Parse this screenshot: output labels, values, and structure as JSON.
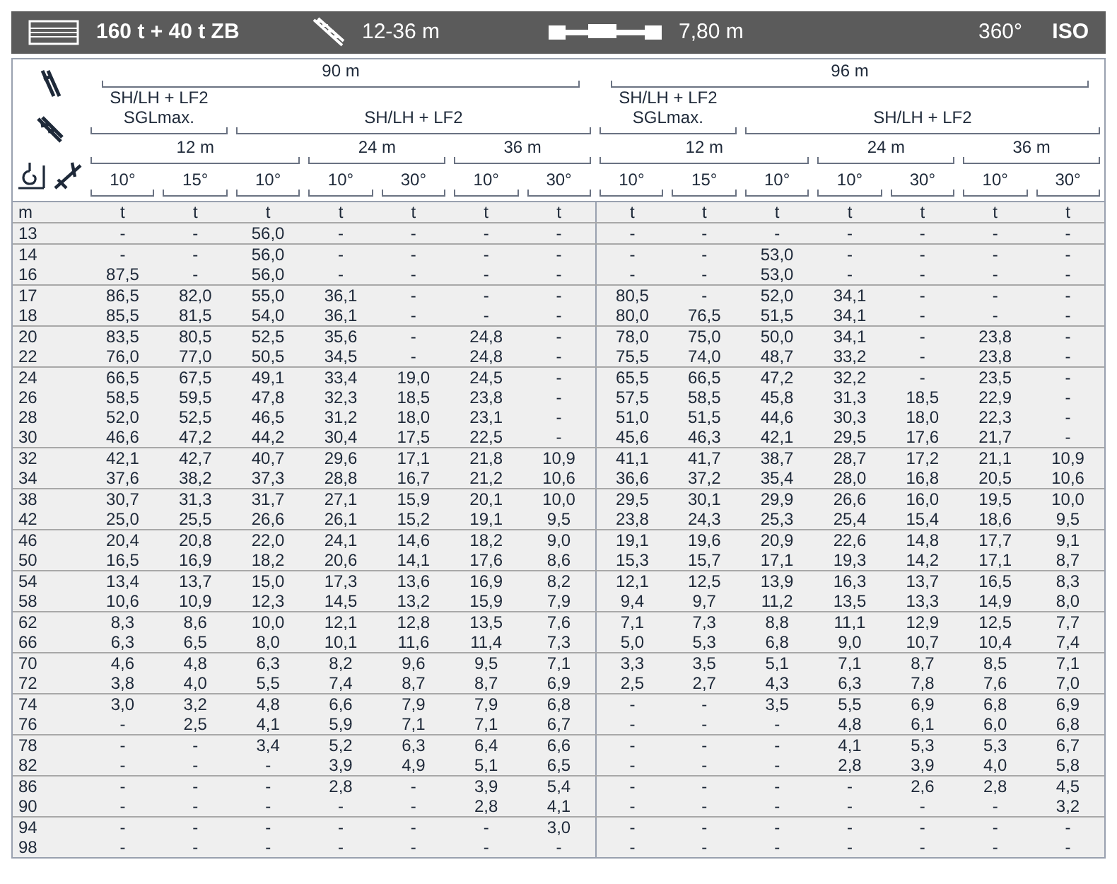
{
  "title_bar": {
    "counterweight": "160 t + 40 t ZB",
    "jib_range": "12-36 m",
    "outrigger_base": "7,80 m",
    "slewing": "360°",
    "standard": "ISO"
  },
  "halves": [
    {
      "main_boom": "90 m",
      "configs": [
        {
          "lines": [
            "SH/LH + LF2",
            "SGLmax."
          ]
        },
        {
          "lines": [
            "SH/LH + LF2"
          ]
        }
      ],
      "jibs": [
        {
          "length": "12 m"
        },
        {
          "length": "24 m"
        },
        {
          "length": "36 m"
        }
      ],
      "angles": [
        "10°",
        "15°",
        "10°",
        "10°",
        "30°",
        "10°",
        "30°"
      ]
    },
    {
      "main_boom": "96 m",
      "configs": [
        {
          "lines": [
            "SH/LH + LF2",
            "SGLmax."
          ]
        },
        {
          "lines": [
            "SH/LH + LF2"
          ]
        }
      ],
      "jibs": [
        {
          "length": "12 m"
        },
        {
          "length": "24 m"
        },
        {
          "length": "36 m"
        }
      ],
      "angles": [
        "10°",
        "15°",
        "10°",
        "10°",
        "30°",
        "10°",
        "30°"
      ]
    }
  ],
  "units": [
    "m",
    "t",
    "t",
    "t",
    "t",
    "t",
    "t",
    "t",
    "t",
    "t",
    "t",
    "t",
    "t",
    "t",
    "t"
  ],
  "row_groups": [
    [
      {
        "m": "13",
        "cells": [
          "-",
          "-",
          "56,0",
          "-",
          "-",
          "-",
          "-",
          "-",
          "-",
          "-",
          "-",
          "-",
          "-",
          "-"
        ]
      }
    ],
    [
      {
        "m": "14",
        "cells": [
          "-",
          "-",
          "56,0",
          "-",
          "-",
          "-",
          "-",
          "-",
          "-",
          "53,0",
          "-",
          "-",
          "-",
          "-"
        ]
      },
      {
        "m": "16",
        "cells": [
          "87,5",
          "-",
          "56,0",
          "-",
          "-",
          "-",
          "-",
          "-",
          "-",
          "53,0",
          "-",
          "-",
          "-",
          "-"
        ]
      }
    ],
    [
      {
        "m": "17",
        "cells": [
          "86,5",
          "82,0",
          "55,0",
          "36,1",
          "-",
          "-",
          "-",
          "80,5",
          "-",
          "52,0",
          "34,1",
          "-",
          "-",
          "-"
        ]
      },
      {
        "m": "18",
        "cells": [
          "85,5",
          "81,5",
          "54,0",
          "36,1",
          "-",
          "-",
          "-",
          "80,0",
          "76,5",
          "51,5",
          "34,1",
          "-",
          "-",
          "-"
        ]
      }
    ],
    [
      {
        "m": "20",
        "cells": [
          "83,5",
          "80,5",
          "52,5",
          "35,6",
          "-",
          "24,8",
          "-",
          "78,0",
          "75,0",
          "50,0",
          "34,1",
          "-",
          "23,8",
          "-"
        ]
      },
      {
        "m": "22",
        "cells": [
          "76,0",
          "77,0",
          "50,5",
          "34,5",
          "-",
          "24,8",
          "-",
          "75,5",
          "74,0",
          "48,7",
          "33,2",
          "-",
          "23,8",
          "-"
        ]
      }
    ],
    [
      {
        "m": "24",
        "cells": [
          "66,5",
          "67,5",
          "49,1",
          "33,4",
          "19,0",
          "24,5",
          "-",
          "65,5",
          "66,5",
          "47,2",
          "32,2",
          "-",
          "23,5",
          "-"
        ]
      },
      {
        "m": "26",
        "cells": [
          "58,5",
          "59,5",
          "47,8",
          "32,3",
          "18,5",
          "23,8",
          "-",
          "57,5",
          "58,5",
          "45,8",
          "31,3",
          "18,5",
          "22,9",
          "-"
        ]
      },
      {
        "m": "28",
        "cells": [
          "52,0",
          "52,5",
          "46,5",
          "31,2",
          "18,0",
          "23,1",
          "-",
          "51,0",
          "51,5",
          "44,6",
          "30,3",
          "18,0",
          "22,3",
          "-"
        ]
      },
      {
        "m": "30",
        "cells": [
          "46,6",
          "47,2",
          "44,2",
          "30,4",
          "17,5",
          "22,5",
          "-",
          "45,6",
          "46,3",
          "42,1",
          "29,5",
          "17,6",
          "21,7",
          "-"
        ]
      }
    ],
    [
      {
        "m": "32",
        "cells": [
          "42,1",
          "42,7",
          "40,7",
          "29,6",
          "17,1",
          "21,8",
          "10,9",
          "41,1",
          "41,7",
          "38,7",
          "28,7",
          "17,2",
          "21,1",
          "10,9"
        ]
      },
      {
        "m": "34",
        "cells": [
          "37,6",
          "38,2",
          "37,3",
          "28,8",
          "16,7",
          "21,2",
          "10,6",
          "36,6",
          "37,2",
          "35,4",
          "28,0",
          "16,8",
          "20,5",
          "10,6"
        ]
      }
    ],
    [
      {
        "m": "38",
        "cells": [
          "30,7",
          "31,3",
          "31,7",
          "27,1",
          "15,9",
          "20,1",
          "10,0",
          "29,5",
          "30,1",
          "29,9",
          "26,6",
          "16,0",
          "19,5",
          "10,0"
        ]
      },
      {
        "m": "42",
        "cells": [
          "25,0",
          "25,5",
          "26,6",
          "26,1",
          "15,2",
          "19,1",
          "9,5",
          "23,8",
          "24,3",
          "25,3",
          "25,4",
          "15,4",
          "18,6",
          "9,5"
        ]
      }
    ],
    [
      {
        "m": "46",
        "cells": [
          "20,4",
          "20,8",
          "22,0",
          "24,1",
          "14,6",
          "18,2",
          "9,0",
          "19,1",
          "19,6",
          "20,9",
          "22,6",
          "14,8",
          "17,7",
          "9,1"
        ]
      },
      {
        "m": "50",
        "cells": [
          "16,5",
          "16,9",
          "18,2",
          "20,6",
          "14,1",
          "17,6",
          "8,6",
          "15,3",
          "15,7",
          "17,1",
          "19,3",
          "14,2",
          "17,1",
          "8,7"
        ]
      }
    ],
    [
      {
        "m": "54",
        "cells": [
          "13,4",
          "13,7",
          "15,0",
          "17,3",
          "13,6",
          "16,9",
          "8,2",
          "12,1",
          "12,5",
          "13,9",
          "16,3",
          "13,7",
          "16,5",
          "8,3"
        ]
      },
      {
        "m": "58",
        "cells": [
          "10,6",
          "10,9",
          "12,3",
          "14,5",
          "13,2",
          "15,9",
          "7,9",
          "9,4",
          "9,7",
          "11,2",
          "13,5",
          "13,3",
          "14,9",
          "8,0"
        ]
      }
    ],
    [
      {
        "m": "62",
        "cells": [
          "8,3",
          "8,6",
          "10,0",
          "12,1",
          "12,8",
          "13,5",
          "7,6",
          "7,1",
          "7,3",
          "8,8",
          "11,1",
          "12,9",
          "12,5",
          "7,7"
        ]
      },
      {
        "m": "66",
        "cells": [
          "6,3",
          "6,5",
          "8,0",
          "10,1",
          "11,6",
          "11,4",
          "7,3",
          "5,0",
          "5,3",
          "6,8",
          "9,0",
          "10,7",
          "10,4",
          "7,4"
        ]
      }
    ],
    [
      {
        "m": "70",
        "cells": [
          "4,6",
          "4,8",
          "6,3",
          "8,2",
          "9,6",
          "9,5",
          "7,1",
          "3,3",
          "3,5",
          "5,1",
          "7,1",
          "8,7",
          "8,5",
          "7,1"
        ]
      },
      {
        "m": "72",
        "cells": [
          "3,8",
          "4,0",
          "5,5",
          "7,4",
          "8,7",
          "8,7",
          "6,9",
          "2,5",
          "2,7",
          "4,3",
          "6,3",
          "7,8",
          "7,6",
          "7,0"
        ]
      }
    ],
    [
      {
        "m": "74",
        "cells": [
          "3,0",
          "3,2",
          "4,8",
          "6,6",
          "7,9",
          "7,9",
          "6,8",
          "-",
          "-",
          "3,5",
          "5,5",
          "6,9",
          "6,8",
          "6,9"
        ]
      },
      {
        "m": "76",
        "cells": [
          "-",
          "2,5",
          "4,1",
          "5,9",
          "7,1",
          "7,1",
          "6,7",
          "-",
          "-",
          "-",
          "4,8",
          "6,1",
          "6,0",
          "6,8"
        ]
      }
    ],
    [
      {
        "m": "78",
        "cells": [
          "-",
          "-",
          "3,4",
          "5,2",
          "6,3",
          "6,4",
          "6,6",
          "-",
          "-",
          "-",
          "4,1",
          "5,3",
          "5,3",
          "6,7"
        ]
      },
      {
        "m": "82",
        "cells": [
          "-",
          "-",
          "-",
          "3,9",
          "4,9",
          "5,1",
          "6,5",
          "-",
          "-",
          "-",
          "2,8",
          "3,9",
          "4,0",
          "5,8"
        ]
      }
    ],
    [
      {
        "m": "86",
        "cells": [
          "-",
          "-",
          "-",
          "2,8",
          "-",
          "3,9",
          "5,4",
          "-",
          "-",
          "-",
          "-",
          "2,6",
          "2,8",
          "4,5"
        ]
      },
      {
        "m": "90",
        "cells": [
          "-",
          "-",
          "-",
          "-",
          "-",
          "2,8",
          "4,1",
          "-",
          "-",
          "-",
          "-",
          "-",
          "-",
          "3,2"
        ]
      }
    ],
    [
      {
        "m": "94",
        "cells": [
          "-",
          "-",
          "-",
          "-",
          "-",
          "-",
          "3,0",
          "-",
          "-",
          "-",
          "-",
          "-",
          "-",
          "-"
        ]
      },
      {
        "m": "98",
        "cells": [
          "-",
          "-",
          "-",
          "-",
          "-",
          "-",
          "-",
          "-",
          "-",
          "-",
          "-",
          "-",
          "-",
          "-"
        ]
      }
    ]
  ]
}
